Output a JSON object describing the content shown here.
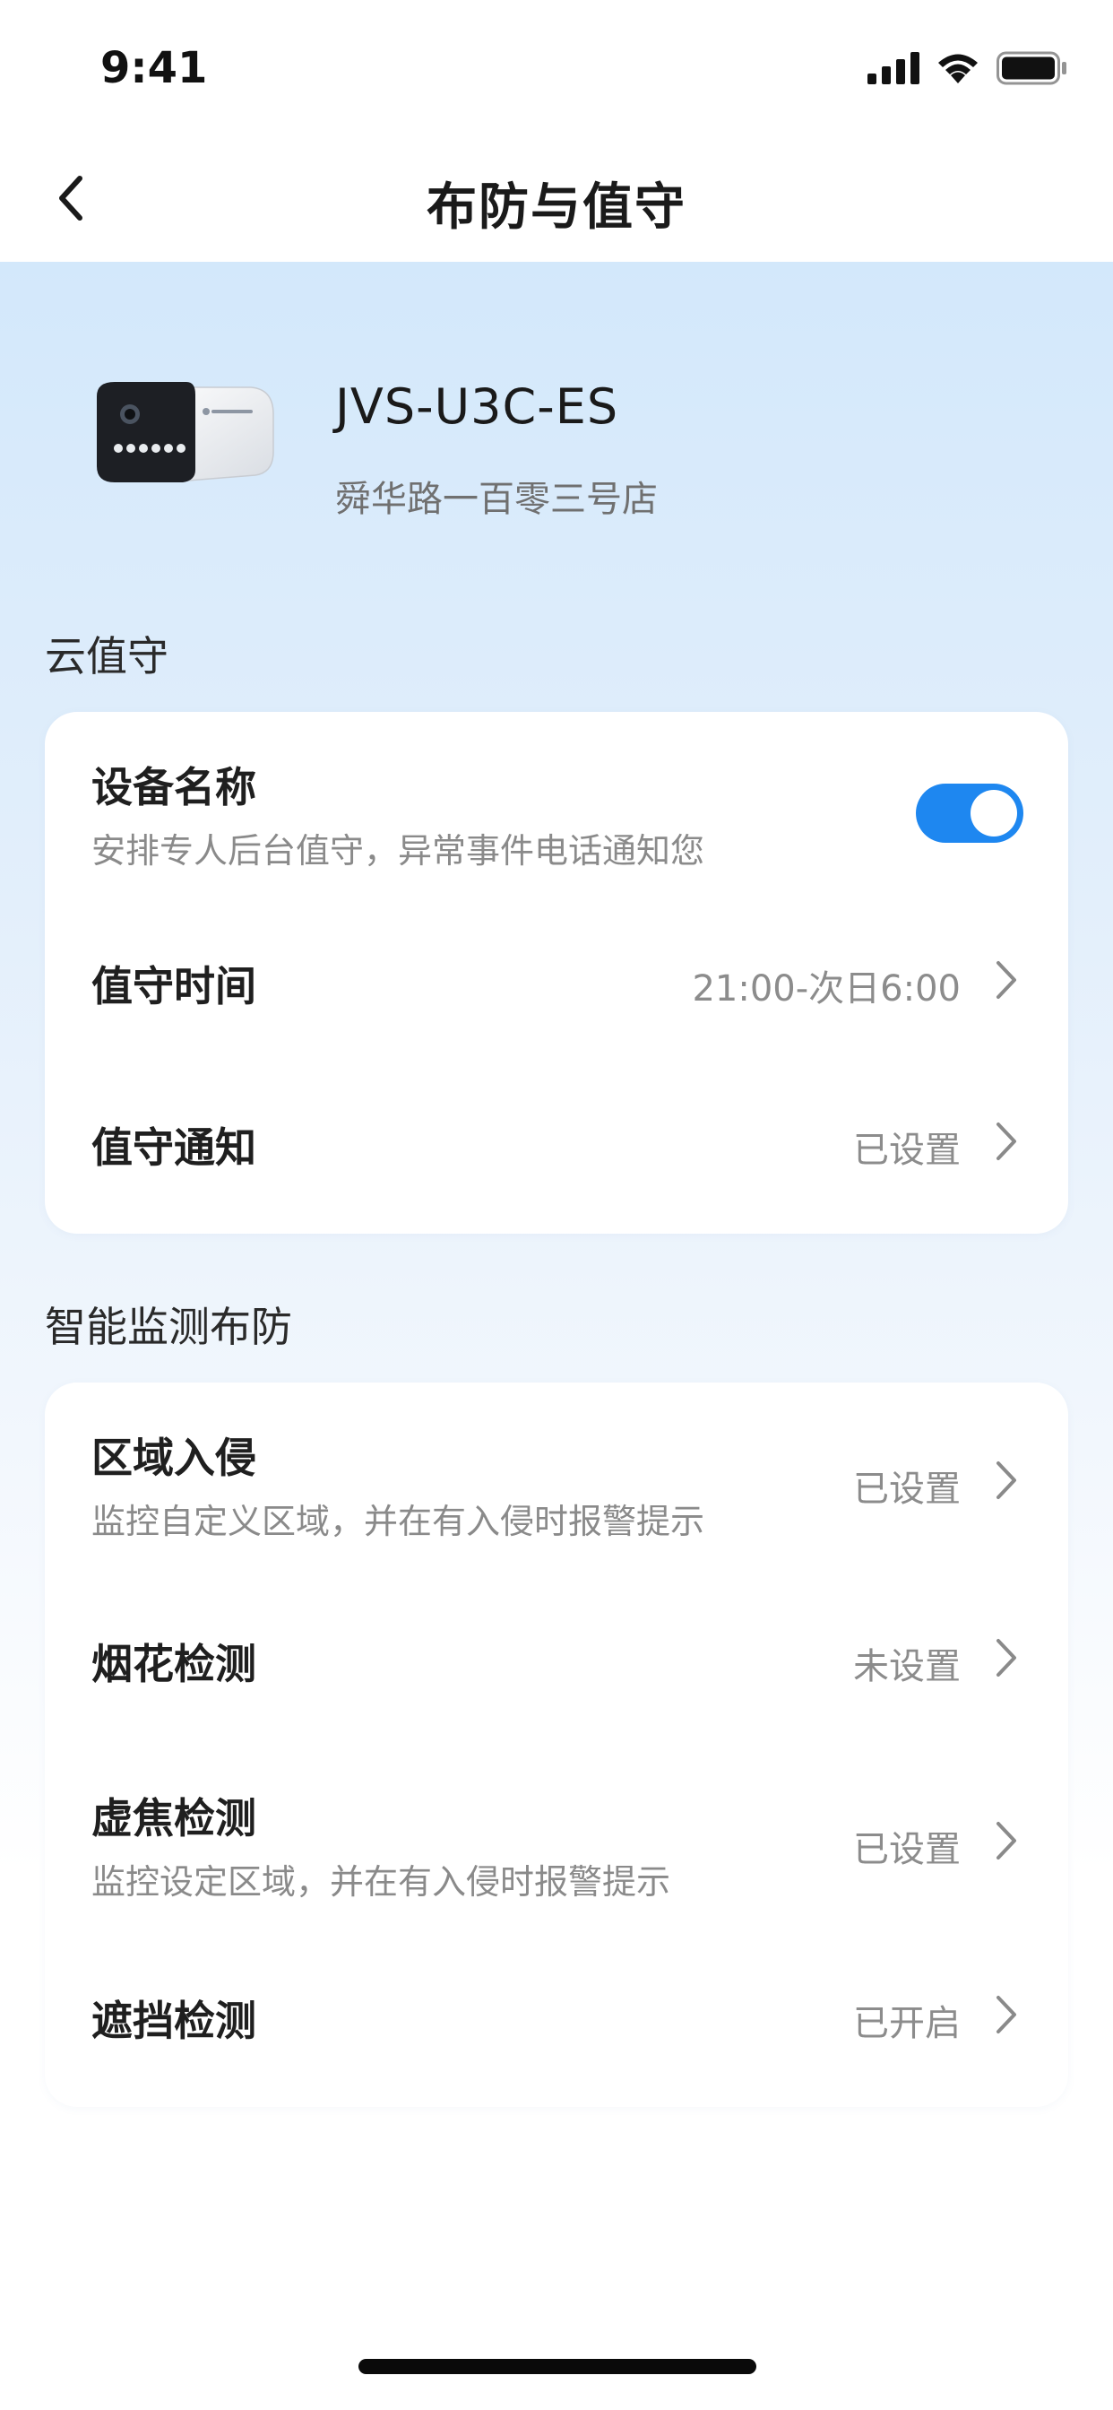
{
  "status_bar": {
    "time": "9:41"
  },
  "nav": {
    "title": "布防与值守"
  },
  "device": {
    "name": "JVS-U3C-ES",
    "location": "舜华路一百零三号店",
    "image_icon": "camera-icon"
  },
  "cloud_guard": {
    "section_title": "云值守",
    "toggle_row": {
      "title": "设备名称",
      "subtitle": "安排专人后台值守，异常事件电话通知您",
      "enabled": true
    },
    "time_row": {
      "title": "值守时间",
      "value": "21:00-次日6:00"
    },
    "notify_row": {
      "title": "值守通知",
      "value": "已设置"
    }
  },
  "smart_detection": {
    "section_title": "智能监测布防",
    "rows": [
      {
        "title": "区域入侵",
        "subtitle": "监控自定义区域，并在有入侵时报警提示",
        "value": "已设置"
      },
      {
        "title": "烟花检测",
        "value": "未设置"
      },
      {
        "title": "虚焦检测",
        "subtitle": "监控设定区域，并在有入侵时报警提示",
        "value": "已设置"
      },
      {
        "title": "遮挡检测",
        "value": "已开启"
      }
    ]
  },
  "colors": {
    "accent": "#1e87f0",
    "background_top": "#d3e8fb"
  }
}
